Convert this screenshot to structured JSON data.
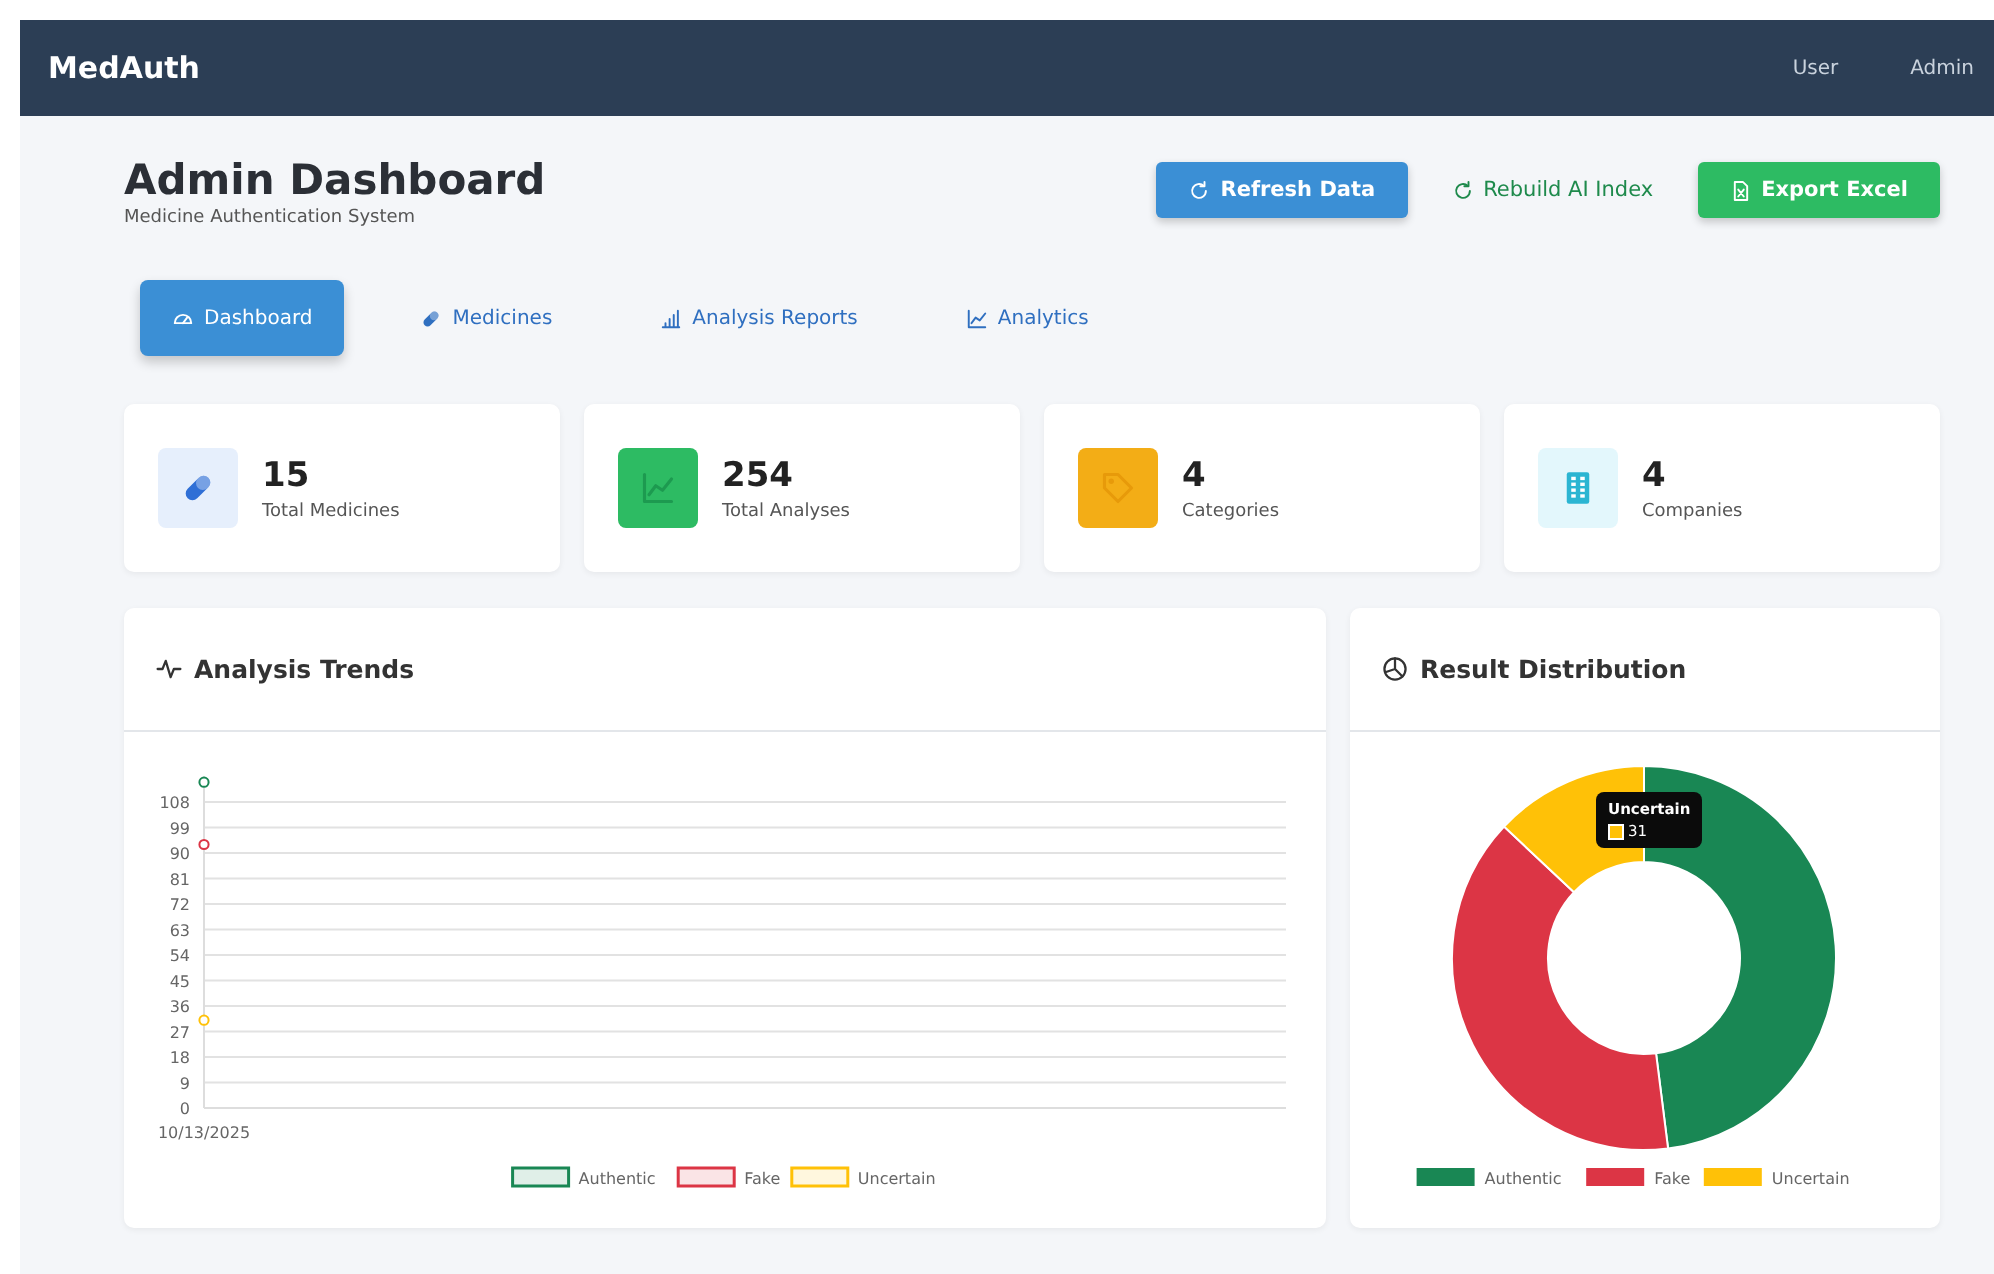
{
  "navbar": {
    "brand": "MedAuth",
    "links": [
      {
        "label": "User"
      },
      {
        "label": "Admin"
      }
    ]
  },
  "header": {
    "title": "Admin Dashboard",
    "subtitle": "Medicine Authentication System",
    "actions": [
      {
        "label": "Refresh Data",
        "kind": "primary"
      },
      {
        "label": "Rebuild AI Index",
        "kind": "link"
      },
      {
        "label": "Export Excel",
        "kind": "success"
      }
    ]
  },
  "tabs": [
    {
      "label": "Dashboard",
      "selected": true
    },
    {
      "label": "Medicines",
      "selected": false
    },
    {
      "label": "Analysis Reports",
      "selected": false
    },
    {
      "label": "Analytics",
      "selected": false
    }
  ],
  "stats": [
    {
      "value": "15",
      "label": "Total Medicines",
      "color": "#e6effc"
    },
    {
      "value": "254",
      "label": "Total Analyses",
      "color": "#2dbb63"
    },
    {
      "value": "4",
      "label": "Categories",
      "color": "#f3ad16"
    },
    {
      "value": "4",
      "label": "Companies",
      "color": "#e3f7fc"
    }
  ],
  "trends": {
    "title": "Analysis Trends",
    "chart_data": {
      "type": "line",
      "categories": [
        "10/13/2025"
      ],
      "ylim": [
        0,
        117
      ],
      "yticks": [
        0,
        9,
        18,
        27,
        36,
        45,
        54,
        63,
        72,
        81,
        90,
        99,
        108
      ],
      "grid": true,
      "legend": "bottom",
      "series": [
        {
          "name": "Authentic",
          "color": "#198754",
          "marker": true,
          "values": [
            115
          ]
        },
        {
          "name": "Fake",
          "color": "#dc3545",
          "marker": true,
          "values": [
            93
          ]
        },
        {
          "name": "Uncertain",
          "color": "#ffc107",
          "marker": true,
          "values": [
            31
          ]
        }
      ]
    }
  },
  "distribution": {
    "title": "Result Distribution",
    "tooltip": {
      "title": "Uncertain",
      "value": "31"
    },
    "chart_data": {
      "type": "donut",
      "categories": [
        "Authentic",
        "Fake",
        "Uncertain"
      ],
      "legend": "bottom",
      "values": [
        48,
        39,
        13
      ]
    }
  }
}
